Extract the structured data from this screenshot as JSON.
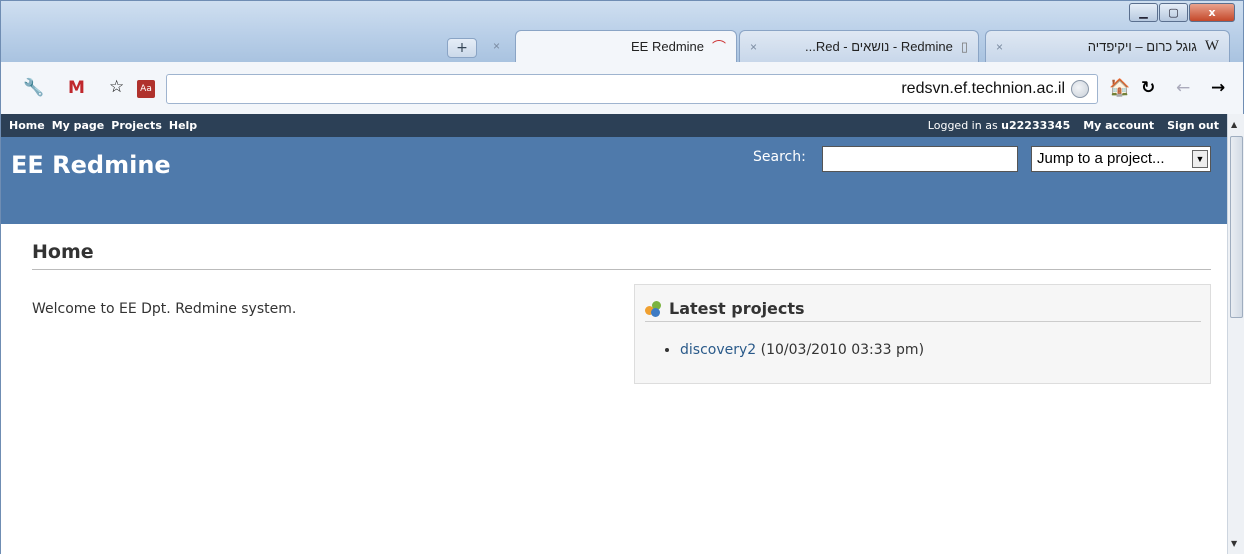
{
  "browser": {
    "tabs": [
      {
        "title": "EE Redmine",
        "active": true
      },
      {
        "title": "...Red - נושאים - Redmine",
        "active": false
      },
      {
        "title": "גוגל כרום – ויקיפדיה",
        "active": false
      }
    ],
    "new_tab_icon": "plus-icon",
    "url": "redsvn.ef.technion.ac.il"
  },
  "top_menu": {
    "left": [
      "Home",
      "My page",
      "Projects",
      "Help"
    ],
    "logged_in_prefix": "Logged in as",
    "username": "u22233345",
    "my_account": "My account",
    "sign_out": "Sign out"
  },
  "header": {
    "title": "EE Redmine",
    "search_label": "Search:",
    "jump_label": "Jump to a project..."
  },
  "main": {
    "heading": "Home",
    "welcome": "Welcome to EE Dpt. Redmine system.",
    "latest_projects": {
      "title": "Latest projects",
      "items": [
        {
          "name": "discovery2",
          "date": "(10/03/2010 03:33 pm)"
        }
      ]
    }
  }
}
